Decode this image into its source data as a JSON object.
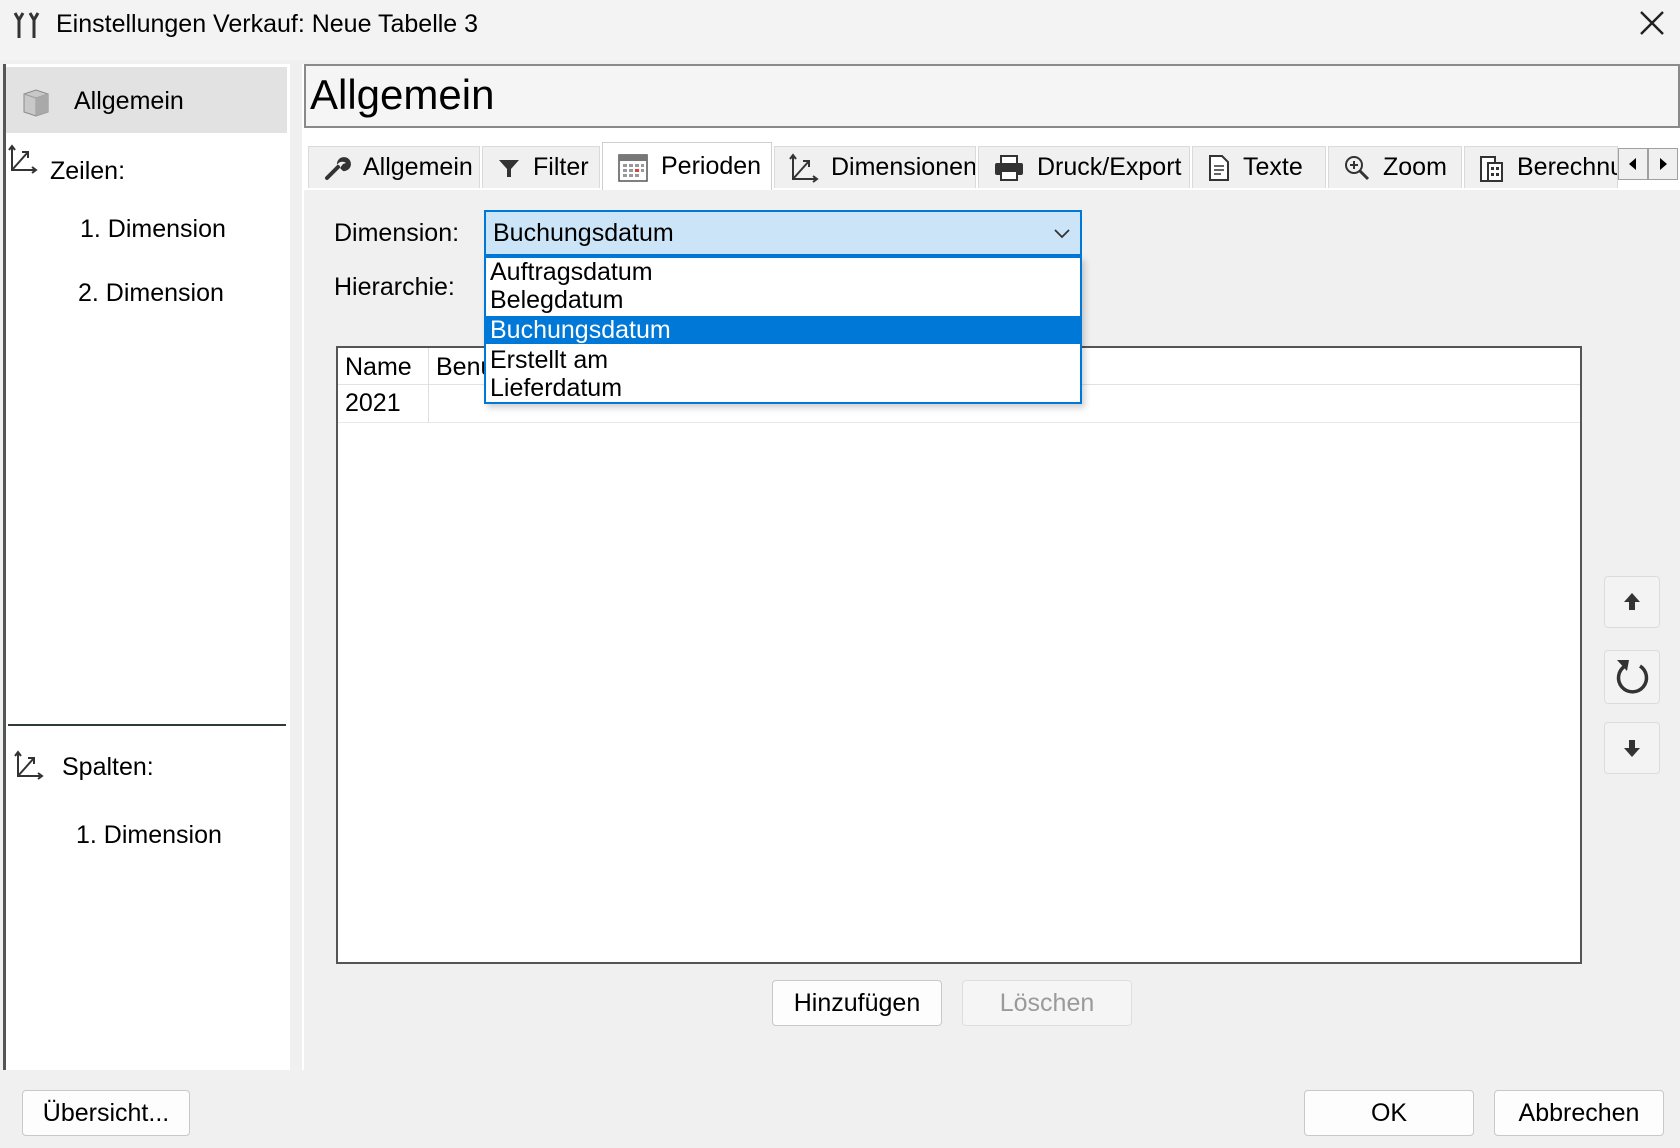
{
  "window": {
    "title": "Einstellungen Verkauf: Neue Tabelle 3"
  },
  "sidebar": {
    "selected_label": "Allgemein",
    "rows_label": "Zeilen:",
    "rows_items": [
      "1. Dimension",
      "2. Dimension"
    ],
    "columns_label": "Spalten:",
    "columns_items": [
      "1. Dimension"
    ]
  },
  "page": {
    "title": "Allgemein"
  },
  "tabs": [
    {
      "label": "Allgemein",
      "icon": "wrench-icon"
    },
    {
      "label": "Filter",
      "icon": "filter-icon"
    },
    {
      "label": "Perioden",
      "icon": "calendar-icon",
      "active": true
    },
    {
      "label": "Dimensionen",
      "icon": "axes-icon"
    },
    {
      "label": "Druck/Export",
      "icon": "printer-icon"
    },
    {
      "label": "Texte",
      "icon": "document-icon"
    },
    {
      "label": "Zoom",
      "icon": "zoom-icon"
    },
    {
      "label": "Berechnu",
      "icon": "calculator-icon"
    }
  ],
  "form": {
    "dimension_label": "Dimension:",
    "dimension_value": "Buchungsdatum",
    "hierarchy_label": "Hierarchie:",
    "dimension_options": [
      "Auftragsdatum",
      "Belegdatum",
      "Buchungsdatum",
      "Erstellt am",
      "Lieferdatum"
    ],
    "selected_option_index": 2
  },
  "grid": {
    "columns": [
      "Name",
      "Benu"
    ],
    "rows": [
      [
        "2021",
        ""
      ]
    ]
  },
  "buttons": {
    "add": "Hinzufügen",
    "delete": "Löschen",
    "overview": "Übersicht...",
    "ok": "OK",
    "cancel": "Abbrechen"
  },
  "colors": {
    "accent": "#0078d7",
    "combo_background": "#cce4f7",
    "window_background": "#f0f0f0"
  }
}
